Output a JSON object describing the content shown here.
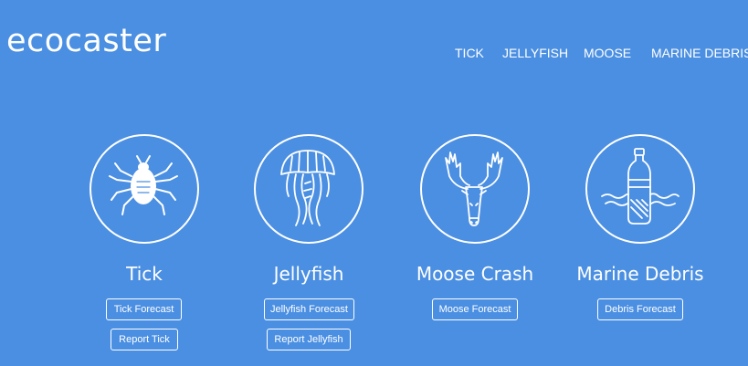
{
  "brand": {
    "name": "ecocaster"
  },
  "nav": {
    "tick": "TICK",
    "jellyfish": "JELLYFISH",
    "moose": "MOOSE",
    "marine_debris": "MARINE DEBRIS"
  },
  "cards": {
    "tick": {
      "icon": "tick-icon",
      "title": "Tick",
      "forecast_label": "Tick Forecast",
      "report_label": "Report Tick"
    },
    "jellyfish": {
      "icon": "jellyfish-icon",
      "title": "Jellyfish",
      "forecast_label": "Jellyfish Forecast",
      "report_label": "Report Jellyfish"
    },
    "moose": {
      "icon": "moose-icon",
      "title": "Moose Crash",
      "forecast_label": "Moose Forecast"
    },
    "debris": {
      "icon": "bottle-icon",
      "title": "Marine Debris",
      "forecast_label": "Debris Forecast"
    }
  },
  "colors": {
    "background": "#4b8fe2",
    "foreground": "#ffffff"
  }
}
